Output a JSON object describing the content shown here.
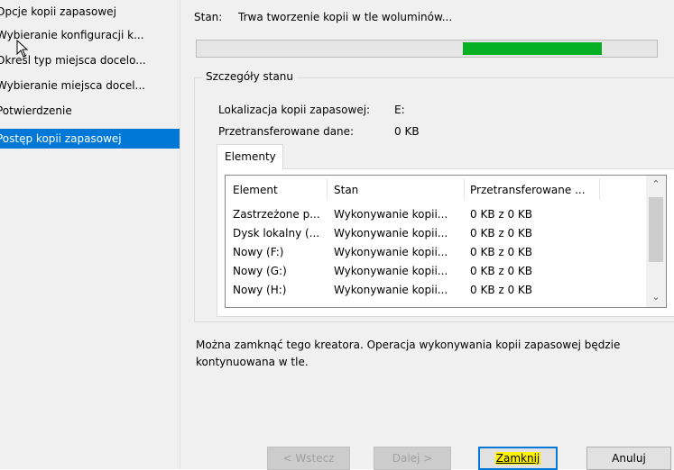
{
  "sidebar": {
    "items": [
      {
        "label": "Opcje kopii zapasowej"
      },
      {
        "label": "Wybieranie konfiguracji k..."
      },
      {
        "label": "Określ typ miejsca docelo..."
      },
      {
        "label": "Wybieranie miejsca docel..."
      },
      {
        "label": "Potwierdzenie"
      },
      {
        "label": "Postęp kopii zapasowej"
      }
    ],
    "active_index": 5
  },
  "status": {
    "label": "Stan:",
    "text": "Trwa tworzenie kopii w tle woluminów...",
    "progress_indeterminate": true
  },
  "details": {
    "group_title": "Szczegóły stanu",
    "location_label": "Lokalizacja kopii zapasowej:",
    "location_value": "E:",
    "transferred_label": "Przetransferowane dane:",
    "transferred_value": "0 KB"
  },
  "elements_tab": {
    "tab_label": "Elementy",
    "columns": [
      "Element",
      "Stan",
      "Przetransferowane ..."
    ],
    "rows": [
      [
        "Zastrzeżone p...",
        "Wykonywanie kopii...",
        "0 KB z 0 KB"
      ],
      [
        "Dysk lokalny (...",
        "Wykonywanie kopii...",
        "0 KB z 0 KB"
      ],
      [
        "Nowy (F:)",
        "Wykonywanie kopii...",
        "0 KB z 0 KB"
      ],
      [
        "Nowy (G:)",
        "Wykonywanie kopii...",
        "0 KB z 0 KB"
      ],
      [
        "Nowy (H:)",
        "Wykonywanie kopii...",
        "0 KB z 0 KB"
      ]
    ]
  },
  "info_text": "Można zamknąć tego kreatora. Operacja wykonywania kopii zapasowej będzie kontynuowana w tle.",
  "buttons": {
    "back": "< Wstecz",
    "next": "Dalej >",
    "close": "Zamknij",
    "cancel": "Anuluj"
  },
  "colors": {
    "sidebar_active": "#0078d7",
    "progress_fill": "#06b025",
    "highlight": "#fff200"
  }
}
